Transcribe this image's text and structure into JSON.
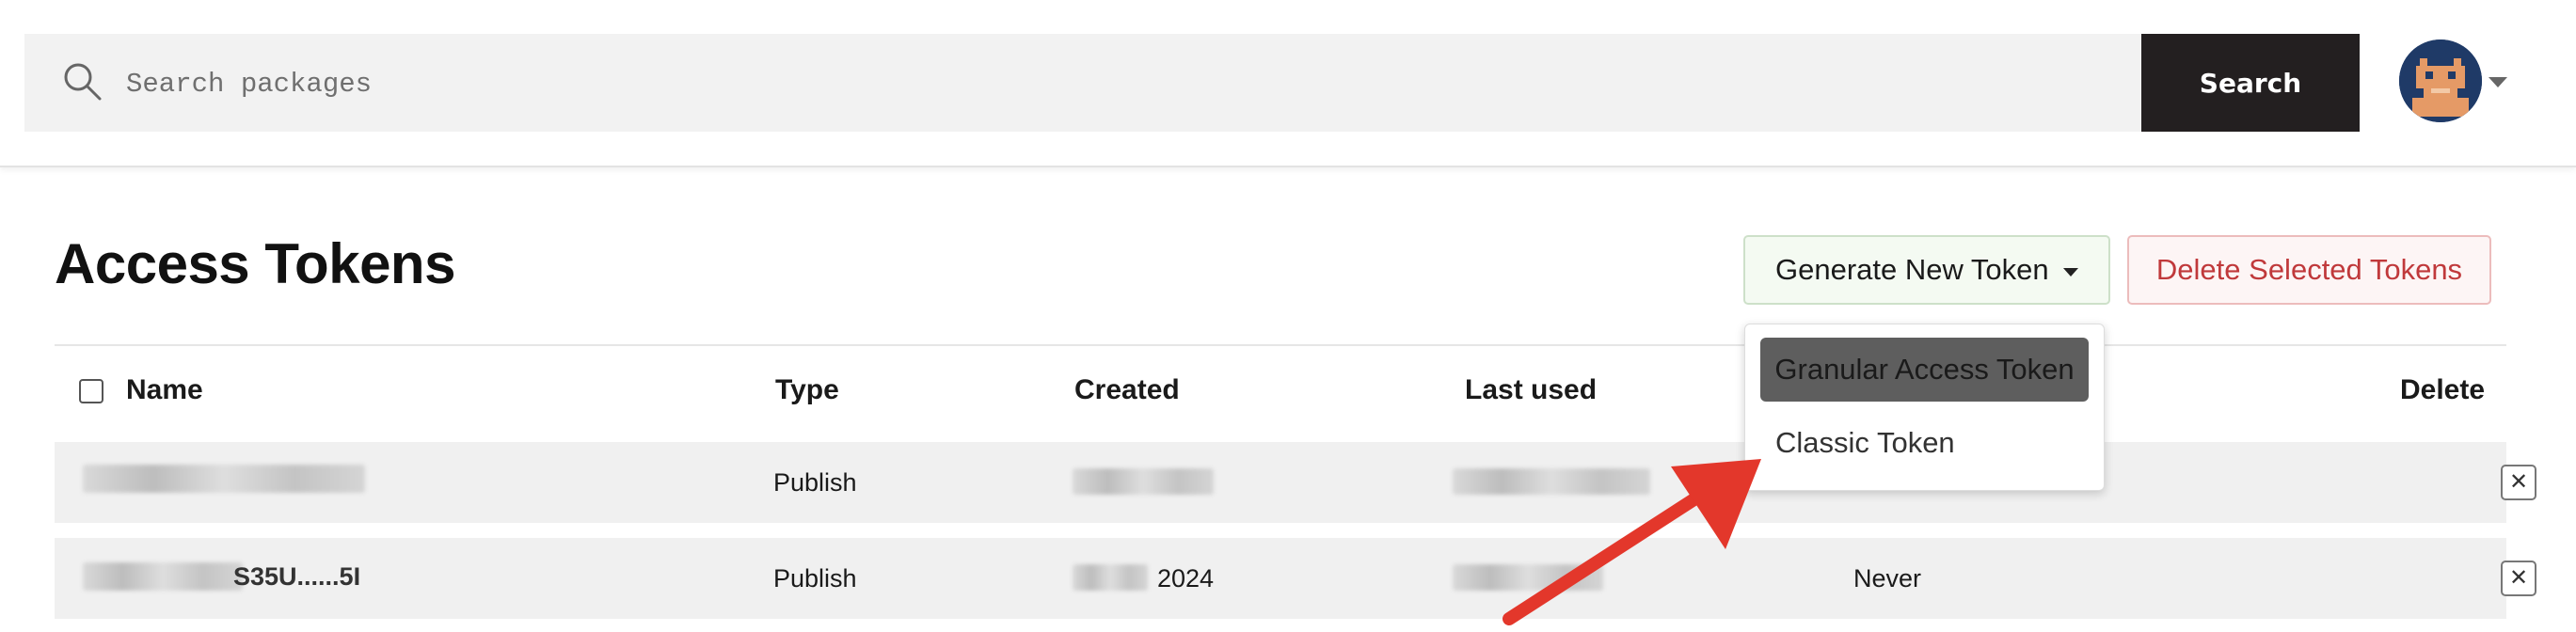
{
  "header": {
    "search_placeholder": "Search packages",
    "search_button": "Search",
    "avatar_icon": "pixel-avatar-icon"
  },
  "page": {
    "title": "Access Tokens",
    "generate_button": "Generate New Token",
    "delete_selected_button": "Delete Selected Tokens"
  },
  "table": {
    "columns": [
      "Name",
      "Type",
      "Created",
      "Last used",
      "Delete"
    ],
    "rows": [
      {
        "name": "",
        "type": "Publish",
        "created": "",
        "last_used": "",
        "expires": ""
      },
      {
        "name": "S35U......5I",
        "type": "Publish",
        "created": "2024",
        "last_used": "",
        "expires": "Never"
      }
    ]
  },
  "dropdown": {
    "items": [
      "Granular Access Token",
      "Classic Token"
    ]
  },
  "colors": {
    "search_button_bg": "#231f20",
    "delete_text": "#c0393b",
    "generate_bg": "#f4faf2",
    "annotation_arrow": "#e3372b"
  }
}
